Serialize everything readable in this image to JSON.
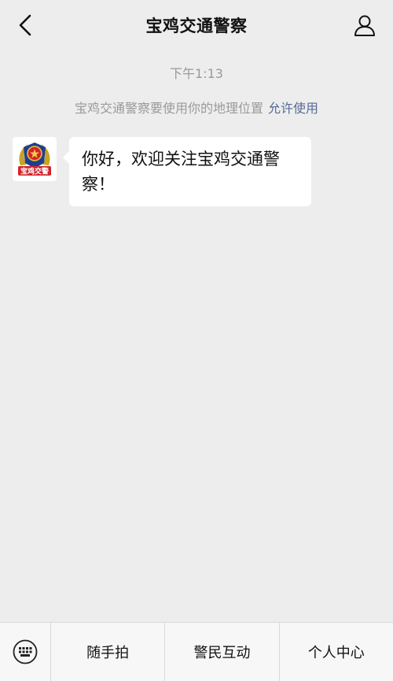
{
  "header": {
    "title": "宝鸡交通警察",
    "back_icon": "chevron-left-icon",
    "profile_icon": "person-icon"
  },
  "chat": {
    "timestamp": "下午1:13",
    "system_notice": {
      "text": "宝鸡交通警察要使用你的地理位置",
      "action": "允许使用"
    },
    "messages": [
      {
        "sender": "宝鸡交通警察",
        "avatar_text": "宝鸡交警",
        "text": "你好，欢迎关注宝鸡交通警察！"
      }
    ]
  },
  "bottom_menu": {
    "keyboard_icon": "keyboard-icon",
    "items": [
      {
        "label": "随手拍"
      },
      {
        "label": "警民互动"
      },
      {
        "label": "个人中心"
      }
    ]
  },
  "colors": {
    "background": "#ededed",
    "link": "#576b95",
    "muted": "#9a9a9a"
  }
}
